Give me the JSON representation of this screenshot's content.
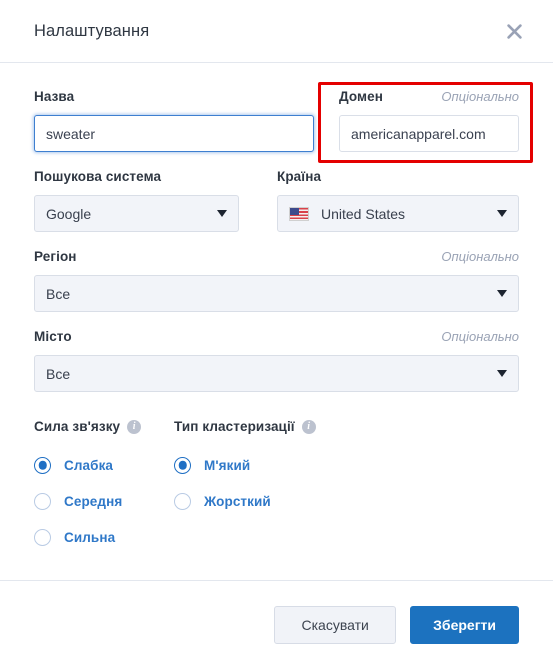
{
  "dialog": {
    "title": "Налаштування",
    "close_icon": "close-icon"
  },
  "form": {
    "name": {
      "label": "Назва",
      "value": "sweater",
      "placeholder": "Назва"
    },
    "domain": {
      "label": "Домен",
      "optional_text": "Опціонально",
      "value": "americanapparel.com",
      "placeholder": "Домен"
    },
    "search_engine": {
      "label": "Пошукова система",
      "value": "Google"
    },
    "country": {
      "label": "Країна",
      "value": "United States",
      "flag_icon": "us-flag-icon"
    },
    "region": {
      "label": "Регіон",
      "optional_text": "Опціонально",
      "value": "Все"
    },
    "city": {
      "label": "Місто",
      "optional_text": "Опціонально",
      "value": "Все"
    }
  },
  "link_strength": {
    "label": "Сила зв'язку",
    "info_icon": "info-icon",
    "options": [
      {
        "label": "Слабка",
        "selected": true
      },
      {
        "label": "Середня",
        "selected": false
      },
      {
        "label": "Сильна",
        "selected": false
      }
    ]
  },
  "cluster_type": {
    "label": "Тип кластеризації",
    "info_icon": "info-icon",
    "options": [
      {
        "label": "М'який",
        "selected": true
      },
      {
        "label": "Жорсткий",
        "selected": false
      }
    ]
  },
  "footer": {
    "cancel_label": "Скасувати",
    "save_label": "Зберегти"
  },
  "annotation": {
    "type": "red-highlight-box",
    "color": "#e40000",
    "target": "domain-field"
  },
  "colors": {
    "accent_blue": "#1c72bf",
    "radio_label_blue": "#2f78c8",
    "focus_blue": "#3e7fd0",
    "annotation_red": "#e40000",
    "select_bg": "#f2f4f9",
    "text_dark": "#2f3742",
    "optional_gray": "#9aa3b5"
  }
}
